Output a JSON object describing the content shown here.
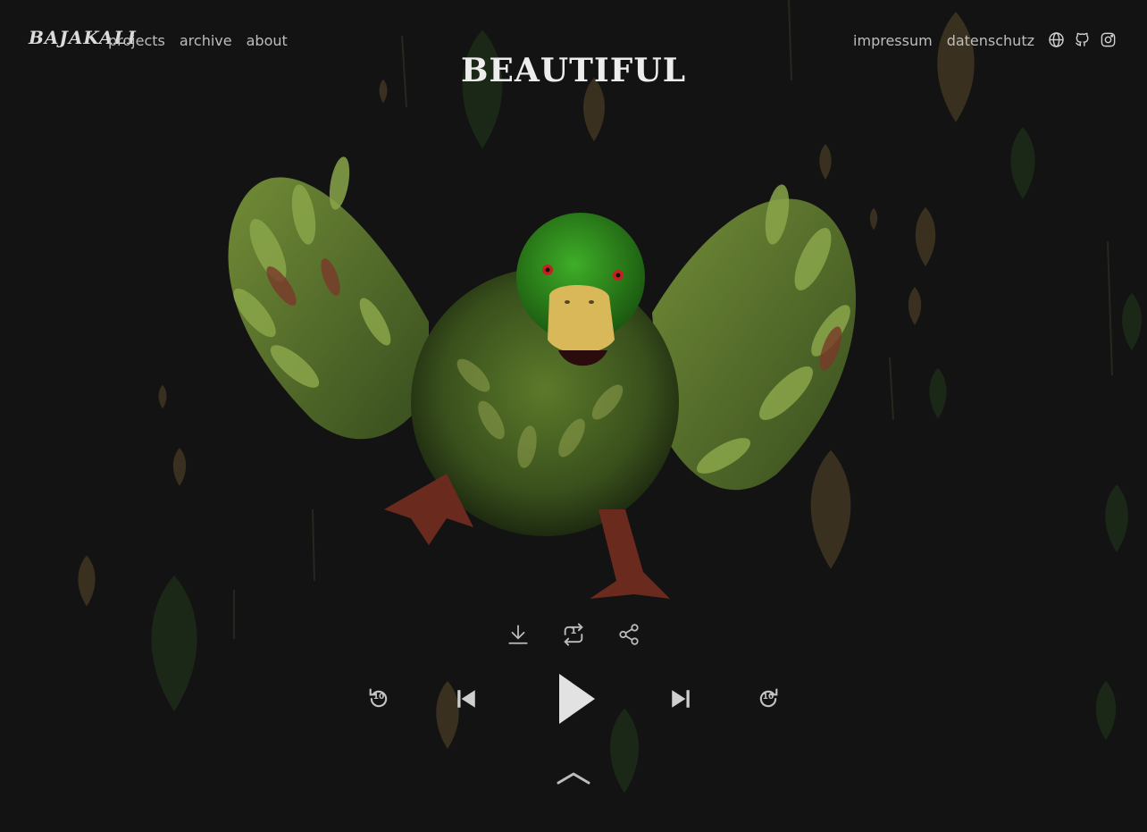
{
  "site": {
    "logo": "BAJAKALI",
    "title": "BEAUTIFUL"
  },
  "nav_left": [
    "projects",
    "archive",
    "about"
  ],
  "nav_right": [
    "impressum",
    "datenschutz"
  ],
  "icons": [
    "globe-icon",
    "github-icon",
    "instagram-icon"
  ],
  "player": {
    "actions": [
      "download-icon",
      "repeat-one-icon",
      "share-icon"
    ],
    "repeat_badge": "1",
    "skip_back_seconds": "10",
    "skip_forward_seconds": "10",
    "controls": [
      "rewind-10-icon",
      "previous-icon",
      "play-icon",
      "next-icon",
      "forward-10-icon"
    ]
  },
  "colors": {
    "background": "#131313",
    "text": "#c9c9c9",
    "leaf_green": "#2e4a24",
    "leaf_brown": "#5a4a2a",
    "duck_green": "#2f8a1c",
    "beak": "#d9b85a"
  }
}
